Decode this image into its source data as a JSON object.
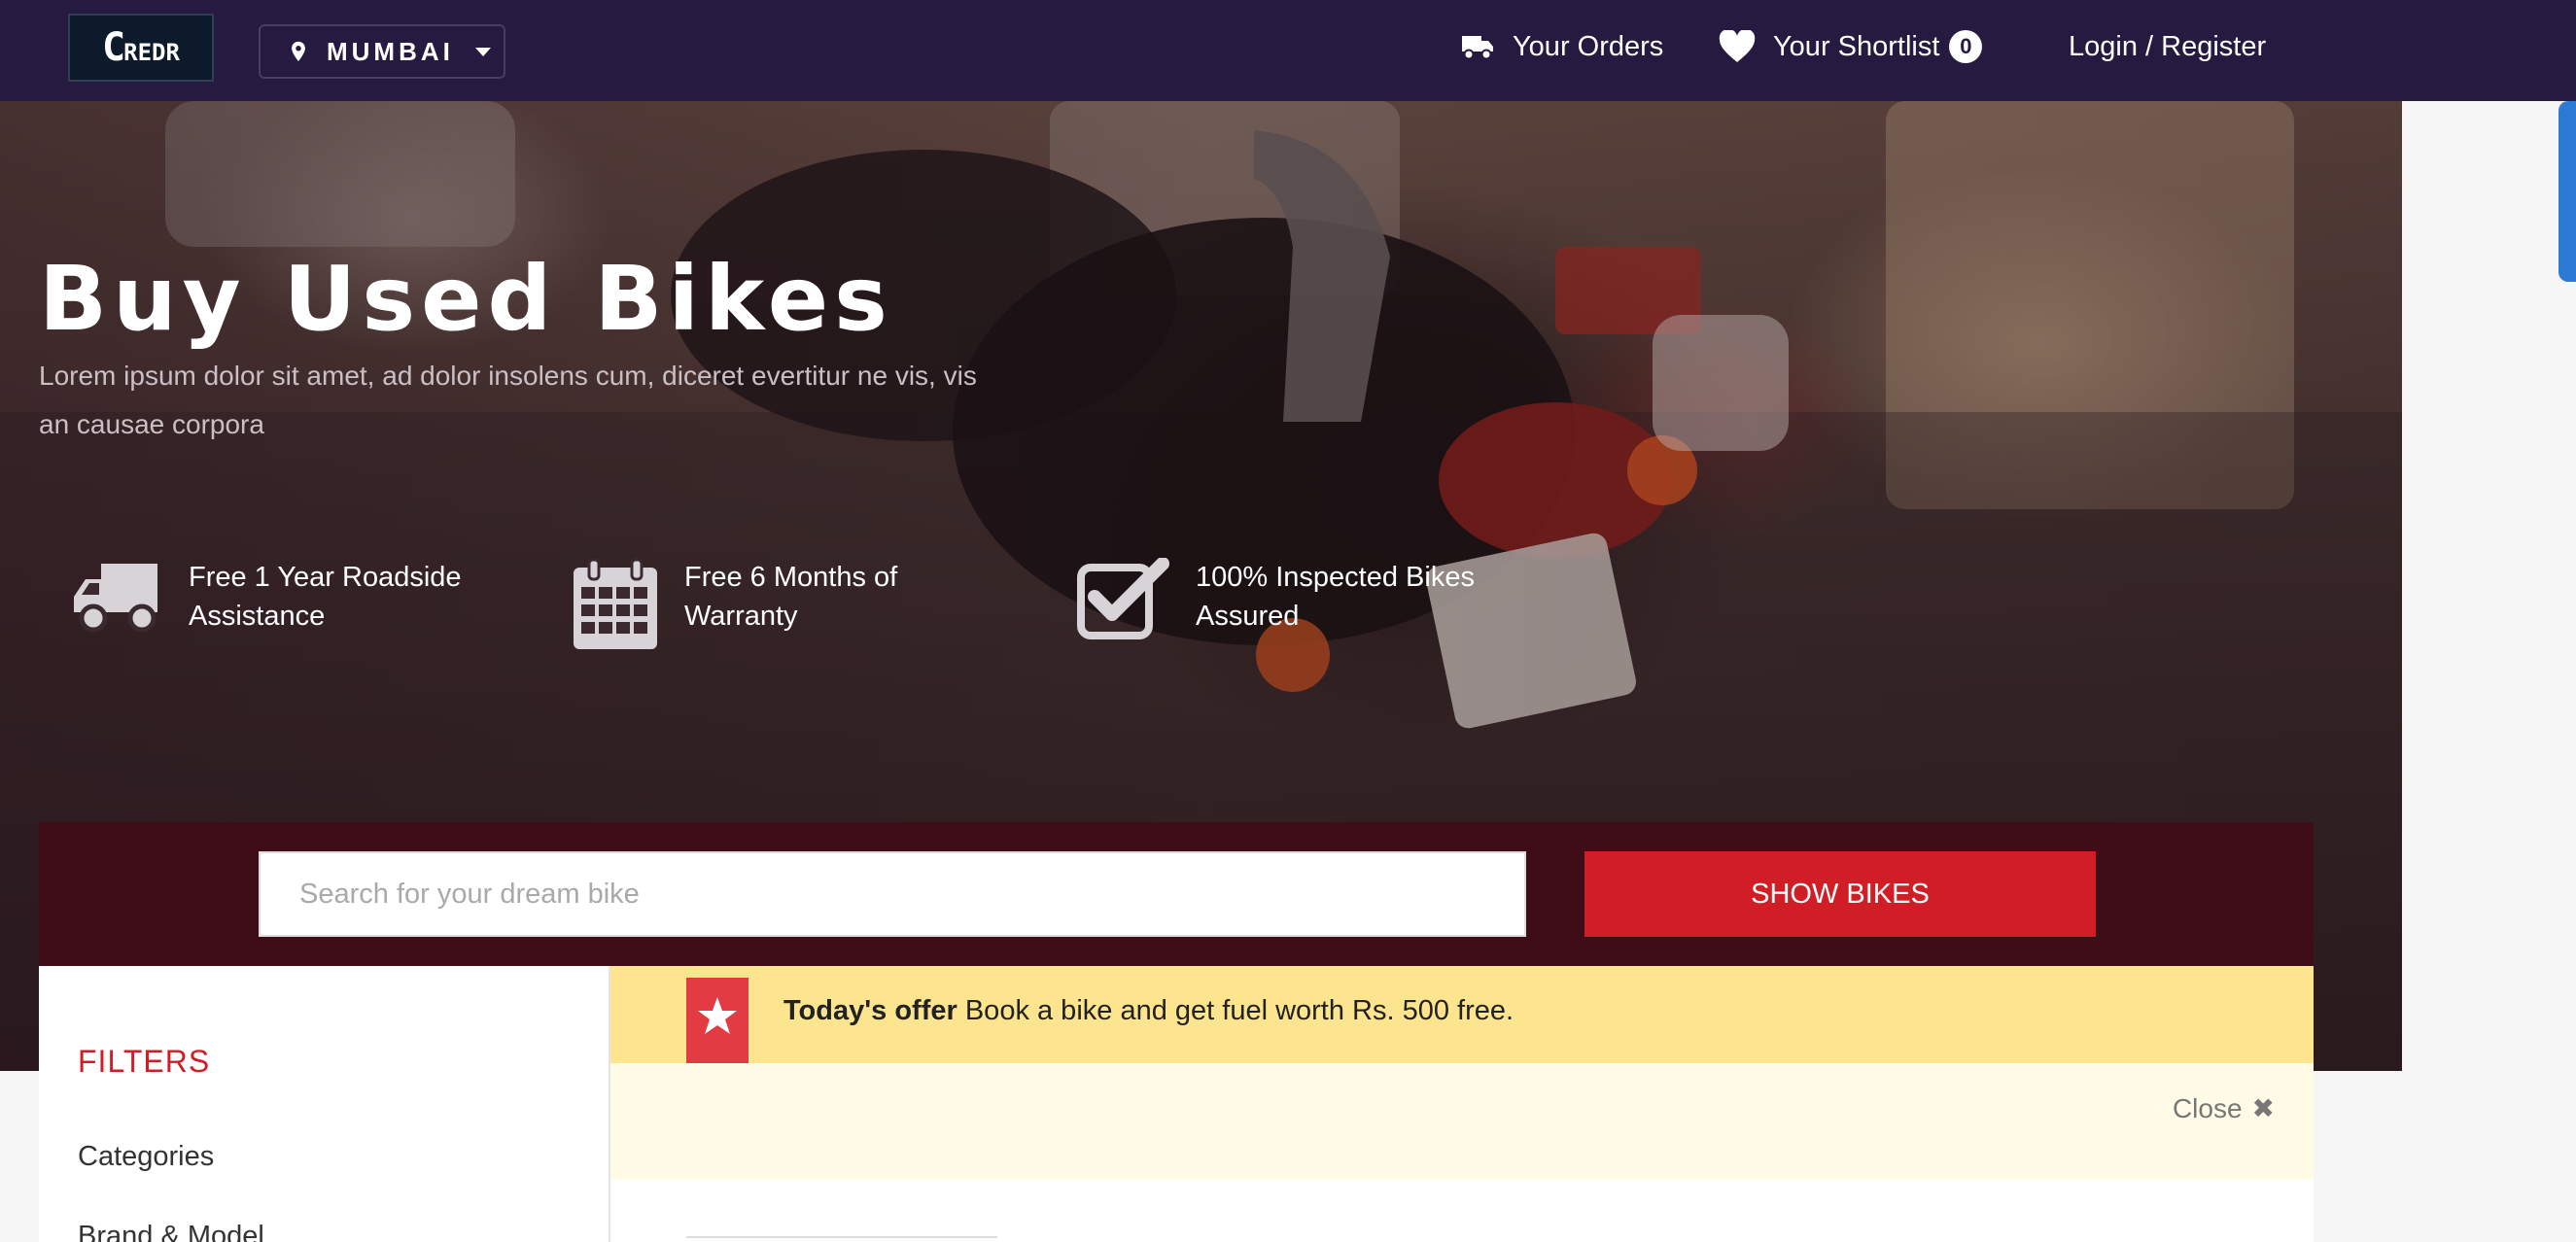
{
  "navbar": {
    "logo_text": "CredR",
    "city": "MUMBAI",
    "orders_label": "Your Orders",
    "shortlist_label": "Your Shortlist",
    "shortlist_count": "0",
    "login_label": "Login / Register",
    "bg_color": "#271a40"
  },
  "hero": {
    "title": "Buy Used Bikes",
    "subtitle": "Lorem ipsum dolor sit amet, ad dolor insolens cum, diceret evertitur ne vis, vis an causae corpora",
    "features": [
      {
        "icon": "truck-icon",
        "text_line1": "Free 1 Year Roadside",
        "text_line2": "Assistance"
      },
      {
        "icon": "calendar-icon",
        "text_line1": "Free 6 Months of",
        "text_line2": "Warranty"
      },
      {
        "icon": "checkbox-icon",
        "text_line1": "100% Inspected Bikes",
        "text_line2": "Assured"
      }
    ]
  },
  "search": {
    "placeholder": "Search for your dream bike",
    "value": "",
    "button_label": "SHOW BIKES",
    "accent_color": "#d11e26",
    "band_color": "#3e0d18"
  },
  "filters": {
    "title": "FILTERS",
    "items": [
      "Categories",
      "Brand & Model"
    ]
  },
  "offer": {
    "label": "Today's offer",
    "text": "Book a bike and get fuel worth Rs. 500 free.",
    "close_label": "Close",
    "bg_color": "#fde48e"
  }
}
